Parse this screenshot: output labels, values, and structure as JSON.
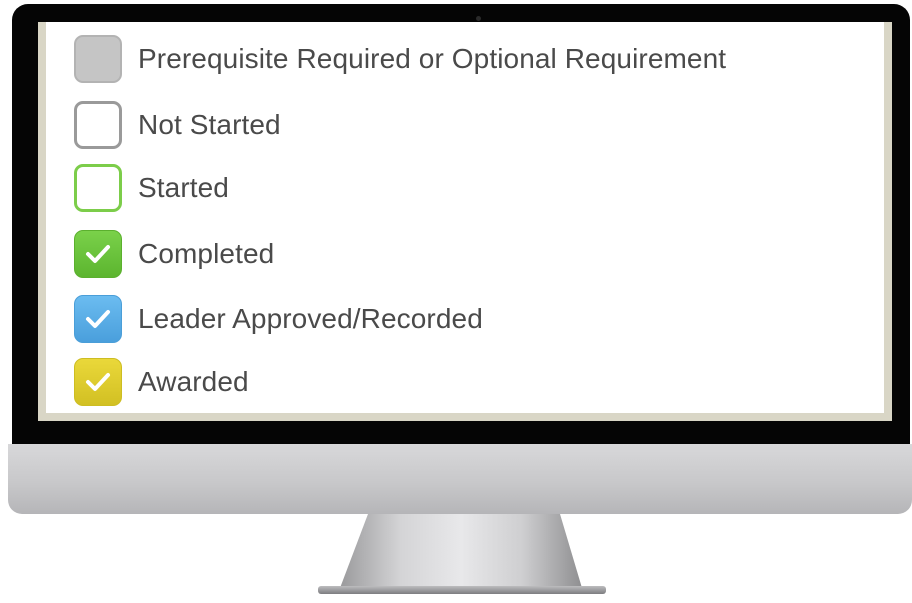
{
  "legend": {
    "items": [
      {
        "label": "Prerequisite Required or Optional Requirement",
        "status": "prerequisite",
        "icon": "gray-filled-box-icon",
        "fill": "#c5c5c5",
        "border": "#b3b3b3",
        "checked": false
      },
      {
        "label": "Not Started",
        "status": "not-started",
        "icon": "empty-box-icon",
        "fill": "#ffffff",
        "border": "#9a9a9a",
        "checked": false
      },
      {
        "label": "Started",
        "status": "started",
        "icon": "green-outline-box-icon",
        "fill": "#ffffff",
        "border": "#7ccd4a",
        "checked": false
      },
      {
        "label": "Completed",
        "status": "completed",
        "icon": "green-check-box-icon",
        "fill": "#6cc23c",
        "border": "#5bb02e",
        "checked": true
      },
      {
        "label": "Leader Approved/Recorded",
        "status": "leader-approved",
        "icon": "blue-check-box-icon",
        "fill": "#5ab0ea",
        "border": "#4a9ed8",
        "checked": true
      },
      {
        "label": "Awarded",
        "status": "awarded",
        "icon": "yellow-check-box-icon",
        "fill": "#e0cf2c",
        "border": "#cdbd22",
        "checked": true
      }
    ]
  },
  "colors": {
    "bezel": "#050505",
    "screen_frame": "#d9d6c6",
    "text": "#4a4a4a"
  }
}
